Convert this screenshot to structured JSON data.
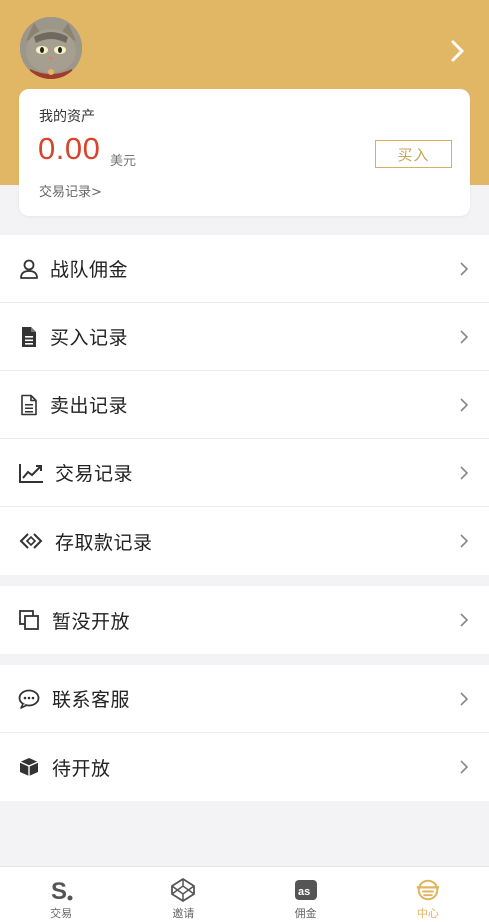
{
  "header": {
    "avatar_alt": "cat-avatar",
    "accent_color": "#e1b765"
  },
  "asset": {
    "title": "我的资产",
    "value": "0.00",
    "unit": "美元",
    "link": "交易记录>",
    "buy_label": "买入"
  },
  "menu_groups": [
    {
      "items": [
        {
          "label": "战队佣金",
          "icon": "user-icon"
        },
        {
          "label": "买入记录",
          "icon": "document-icon"
        },
        {
          "label": "卖出记录",
          "icon": "document-outline-icon"
        },
        {
          "label": "交易记录",
          "icon": "chart-line-icon"
        },
        {
          "label": "存取款记录",
          "icon": "exchange-icon"
        }
      ]
    },
    {
      "items": [
        {
          "label": "暂没开放",
          "icon": "copy-icon"
        }
      ]
    },
    {
      "items": [
        {
          "label": "联系客服",
          "icon": "chat-icon"
        },
        {
          "label": "待开放",
          "icon": "box-icon"
        }
      ]
    }
  ],
  "tabs": [
    {
      "label": "交易",
      "icon": "s-logo-icon",
      "active": false
    },
    {
      "label": "邀请",
      "icon": "codepen-icon",
      "active": false
    },
    {
      "label": "佣金",
      "icon": "lastfm-icon",
      "active": false
    },
    {
      "label": "中心",
      "icon": "center-icon",
      "active": true
    }
  ]
}
